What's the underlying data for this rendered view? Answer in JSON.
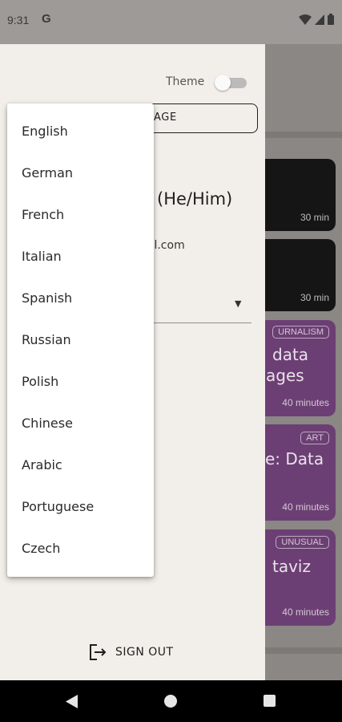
{
  "status_bar": {
    "time": "9:31",
    "app_icon": "G"
  },
  "drawer": {
    "theme_label": "Theme",
    "theme_on": false,
    "language_button_label": "AGE",
    "pronouns": "(He/Him)",
    "email_partial": "ail.com",
    "sign_out_label": "SIGN OUT"
  },
  "language_menu": {
    "items": [
      "English",
      "German",
      "French",
      "Italian",
      "Spanish",
      "Russian",
      "Polish",
      "Chinese",
      "Arabic",
      "Portuguese",
      "Czech"
    ]
  },
  "background_cards": [
    {
      "title": "",
      "tag": "",
      "duration": "30 min"
    },
    {
      "title": "",
      "tag": "",
      "duration": "30 min"
    },
    {
      "title_line1": "data",
      "title_line2": "ages",
      "tag": "URNALISM",
      "duration": "40 minutes"
    },
    {
      "title_line1": "e: Data",
      "tag": "ART",
      "duration": "40 minutes"
    },
    {
      "title_line1": "taviz",
      "tag": "UNUSUAL",
      "duration": "40 minutes"
    }
  ],
  "colors": {
    "drawer_bg": "#f2efea",
    "card_dark": "#151515",
    "card_purple": "#6c3f74",
    "scrim": "#8a8785"
  }
}
